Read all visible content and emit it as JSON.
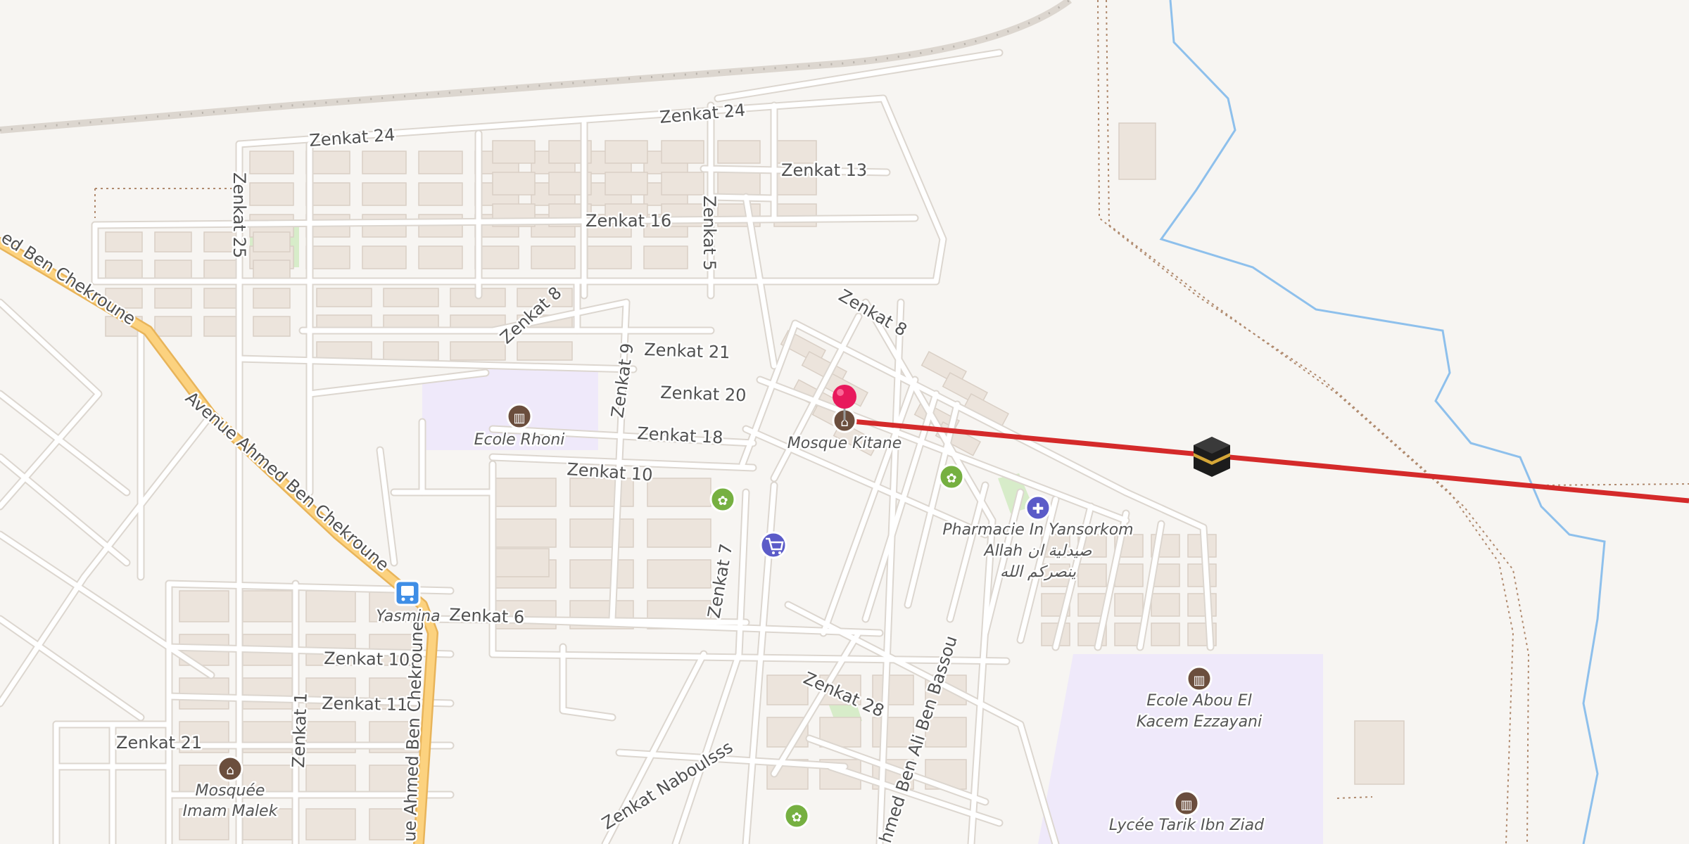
{
  "map": {
    "colors": {
      "background": "#f7f5f2",
      "building": "#ece4dc",
      "building_edge": "#d9cfc5",
      "road": "#ffffff",
      "road_casing": "#dcd6cf",
      "primary_road": "#fcd27f",
      "primary_casing": "#e8b45a",
      "school_area": "#efe9fa",
      "park": "#d7ecc9",
      "river": "#8ec0ec",
      "railway": "#b8b2ab",
      "path": "#b08a6e",
      "qibla_line": "#d42a2a",
      "pin": "#e8195c"
    },
    "street_labels": [
      {
        "id": "zenkat-24-a",
        "text": "Zenkat 24"
      },
      {
        "id": "zenkat-24-b",
        "text": "Zenkat 24"
      },
      {
        "id": "zenkat-13",
        "text": "Zenkat 13"
      },
      {
        "id": "zenkat-25",
        "text": "Zenkat 25"
      },
      {
        "id": "zenkat-16",
        "text": "Zenkat 16"
      },
      {
        "id": "zenkat-5",
        "text": "Zenkat 5"
      },
      {
        "id": "zenkat-8-a",
        "text": "Zenkat 8"
      },
      {
        "id": "zenkat-8-b",
        "text": "Zenkat 8"
      },
      {
        "id": "zenkat-21-a",
        "text": "Zenkat 21"
      },
      {
        "id": "zenkat-9",
        "text": "Zenkat 9"
      },
      {
        "id": "zenkat-20",
        "text": "Zenkat 20"
      },
      {
        "id": "zenkat-18",
        "text": "Zenkat 18"
      },
      {
        "id": "zenkat-10-a",
        "text": "Zenkat 10"
      },
      {
        "id": "zenkat-7",
        "text": "Zenkat 7"
      },
      {
        "id": "zenkat-6",
        "text": "Zenkat 6"
      },
      {
        "id": "zenkat-10-b",
        "text": "Zenkat 10"
      },
      {
        "id": "zenkat-11",
        "text": "Zenkat 11"
      },
      {
        "id": "zenkat-1",
        "text": "Zenkat 1"
      },
      {
        "id": "zenkat-21-b",
        "text": "Zenkat 21"
      },
      {
        "id": "zenkat-28",
        "text": "Zenkat 28"
      },
      {
        "id": "zenkat-naboulsss",
        "text": "Zenkat Naboulsss"
      },
      {
        "id": "ahmed-ben-ali-ben-bassou",
        "text": "hmed Ben Ali Ben Bassou"
      },
      {
        "id": "ahmed-ben-chekroune-top",
        "text": "ed Ben Chekroune"
      },
      {
        "id": "avenue-ahmed-ben-chekroune",
        "text": "Avenue Ahmed Ben Chekroune"
      },
      {
        "id": "ahmed-ben-chekroune-bottom",
        "text": "ue Ahmed Ben Chekroune"
      }
    ],
    "pois": [
      {
        "id": "ecole-rhoni",
        "lines": [
          "Ecole Rhoni"
        ],
        "icon": "school-icon"
      },
      {
        "id": "mosque-kitane",
        "lines": [
          "Mosque Kitane"
        ],
        "icon": "mosque-icon"
      },
      {
        "id": "pharmacie",
        "lines": [
          "Pharmacie In Yansorkom",
          "Allah صيدلية ان",
          "ينصركم الله"
        ],
        "icon": "pharmacy-icon"
      },
      {
        "id": "yasmina",
        "lines": [
          "Yasmina"
        ],
        "icon": "bus-stop-icon"
      },
      {
        "id": "ecole-abou-el-kacem",
        "lines": [
          "Ecole Abou El",
          "Kacem Ezzayani"
        ],
        "icon": "school-icon"
      },
      {
        "id": "mosquee-imam-malek",
        "lines": [
          "Mosquée",
          "Imam Malek"
        ],
        "icon": "mosque-icon"
      },
      {
        "id": "lycee-tarik",
        "lines": [
          "Lycée Tarik Ibn Ziad"
        ],
        "icon": "school-icon"
      }
    ],
    "unlabeled_icons": [
      {
        "id": "garden-1",
        "icon": "garden-center-icon"
      },
      {
        "id": "garden-2",
        "icon": "garden-center-icon"
      },
      {
        "id": "garden-3",
        "icon": "garden-center-icon"
      },
      {
        "id": "supermarket",
        "icon": "shopping-cart-icon"
      },
      {
        "id": "kaaba",
        "icon": "kaaba-icon"
      },
      {
        "id": "pin",
        "icon": "location-pin-icon"
      }
    ]
  }
}
